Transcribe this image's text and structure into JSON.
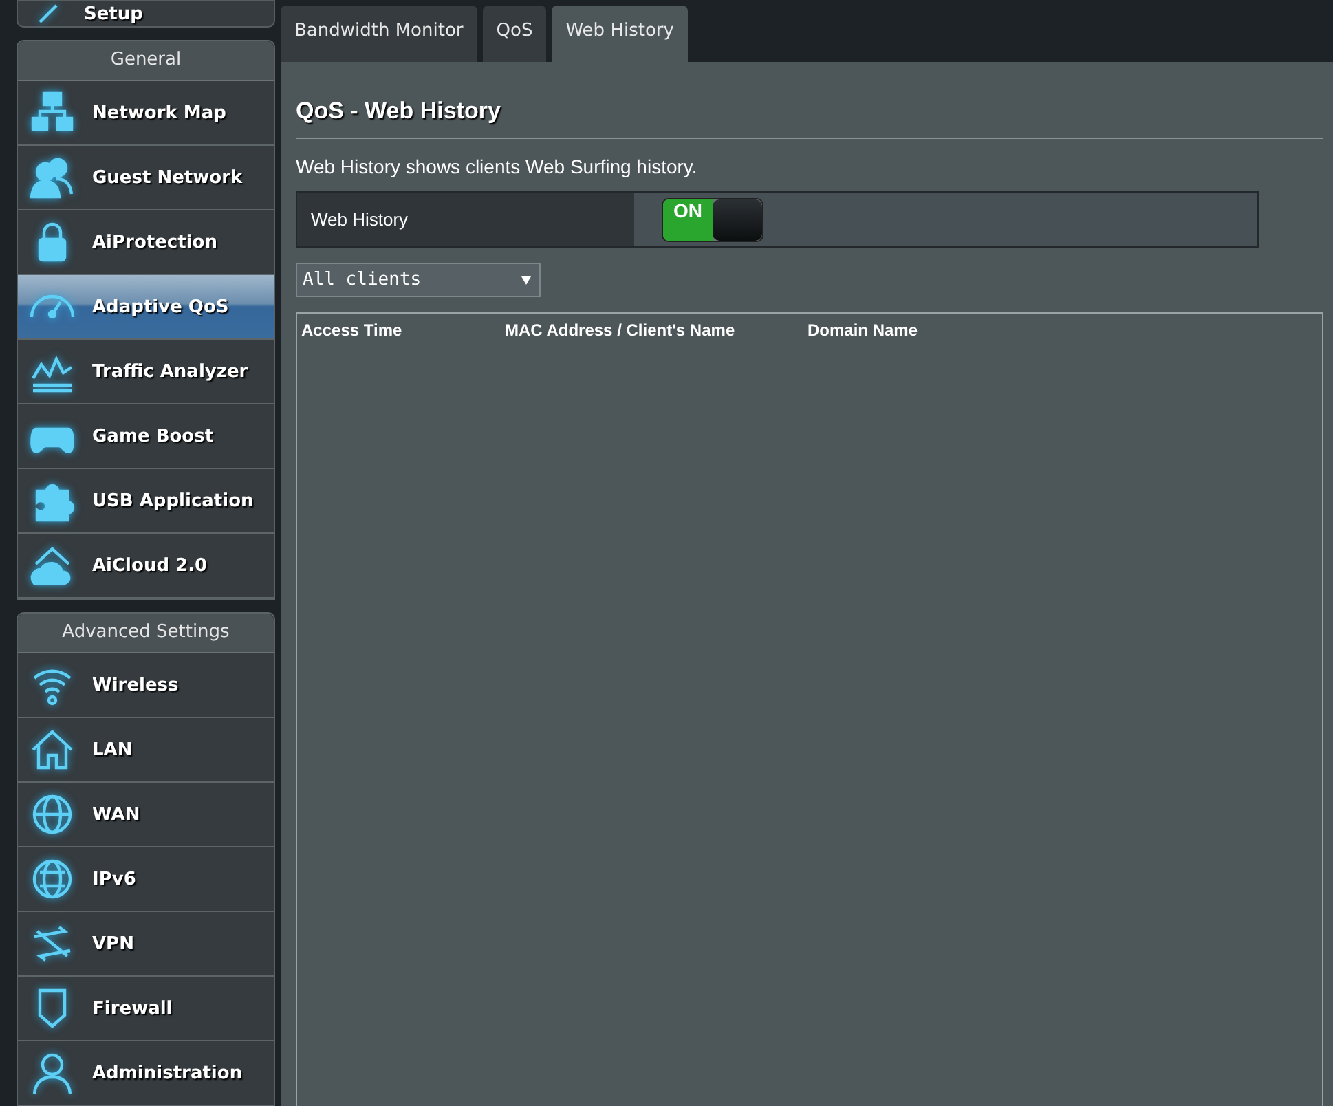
{
  "sidebar": {
    "top_item": {
      "label": "Setup"
    },
    "sections": [
      {
        "header": "General",
        "items": [
          {
            "label": "Network Map",
            "selected": false
          },
          {
            "label": "Guest Network",
            "selected": false
          },
          {
            "label": "AiProtection",
            "selected": false
          },
          {
            "label": "Adaptive QoS",
            "selected": true
          },
          {
            "label": "Traffic Analyzer",
            "selected": false
          },
          {
            "label": "Game Boost",
            "selected": false
          },
          {
            "label": "USB Application",
            "selected": false
          },
          {
            "label": "AiCloud 2.0",
            "selected": false
          }
        ]
      },
      {
        "header": "Advanced Settings",
        "items": [
          {
            "label": "Wireless",
            "selected": false
          },
          {
            "label": "LAN",
            "selected": false
          },
          {
            "label": "WAN",
            "selected": false
          },
          {
            "label": "IPv6",
            "selected": false
          },
          {
            "label": "VPN",
            "selected": false
          },
          {
            "label": "Firewall",
            "selected": false
          },
          {
            "label": "Administration",
            "selected": false
          }
        ]
      }
    ]
  },
  "tabs": [
    {
      "label": "Bandwidth Monitor",
      "selected": false
    },
    {
      "label": "QoS",
      "selected": false
    },
    {
      "label": "Web History",
      "selected": true
    }
  ],
  "page": {
    "title": "QoS - Web History",
    "description": "Web History shows clients Web Surfing history.",
    "setting": {
      "label": "Web History",
      "toggle_text": "ON",
      "on": true
    },
    "client_select": {
      "value": "All clients"
    },
    "table": {
      "columns": [
        "Access Time",
        "MAC Address / Client's Name",
        "Domain Name"
      ]
    }
  }
}
